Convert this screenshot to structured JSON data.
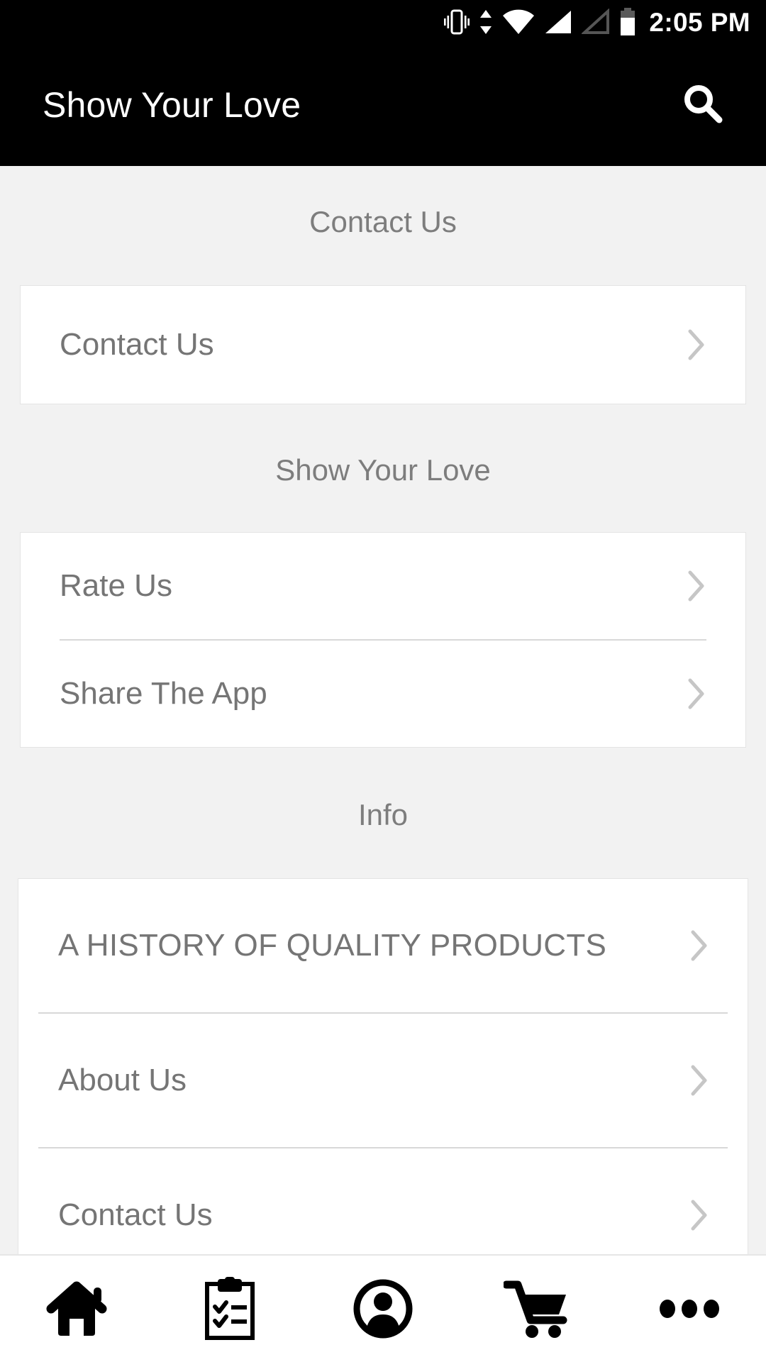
{
  "status_bar": {
    "time": "2:05 PM",
    "icons": [
      "vibrate-icon",
      "data-transfer-icon",
      "wifi-icon",
      "signal-full-icon",
      "signal-empty-icon",
      "battery-icon"
    ]
  },
  "app_bar": {
    "title": "Show Your Love",
    "search_icon": "search-icon",
    "background": "#000000"
  },
  "sections": [
    {
      "header": "Contact Us",
      "rows": [
        {
          "label": "Contact Us",
          "chevron": "chevron-right-icon"
        }
      ]
    },
    {
      "header": "Show Your Love",
      "rows": [
        {
          "label": "Rate Us",
          "chevron": "chevron-right-icon"
        },
        {
          "label": "Share The App",
          "chevron": "chevron-right-icon"
        }
      ]
    },
    {
      "header": "Info",
      "rows": [
        {
          "label": "A HISTORY OF QUALITY PRODUCTS",
          "chevron": "chevron-right-icon"
        },
        {
          "label": "About Us",
          "chevron": "chevron-right-icon"
        },
        {
          "label": "Contact Us",
          "chevron": "chevron-right-icon"
        }
      ]
    }
  ],
  "bottom_nav": {
    "items": [
      {
        "icon": "home-icon",
        "name": "nav-home"
      },
      {
        "icon": "clipboard-checklist-icon",
        "name": "nav-orders"
      },
      {
        "icon": "account-circle-icon",
        "name": "nav-account"
      },
      {
        "icon": "shopping-cart-icon",
        "name": "nav-cart"
      },
      {
        "icon": "more-dots-icon",
        "name": "nav-more"
      }
    ]
  },
  "colors": {
    "background": "#f2f2f2",
    "card": "#ffffff",
    "header_text": "#7d7d7d",
    "row_text": "#757575",
    "app_bar": "#000000",
    "border": "#e4e4e4",
    "divider": "#d8d8d8"
  }
}
